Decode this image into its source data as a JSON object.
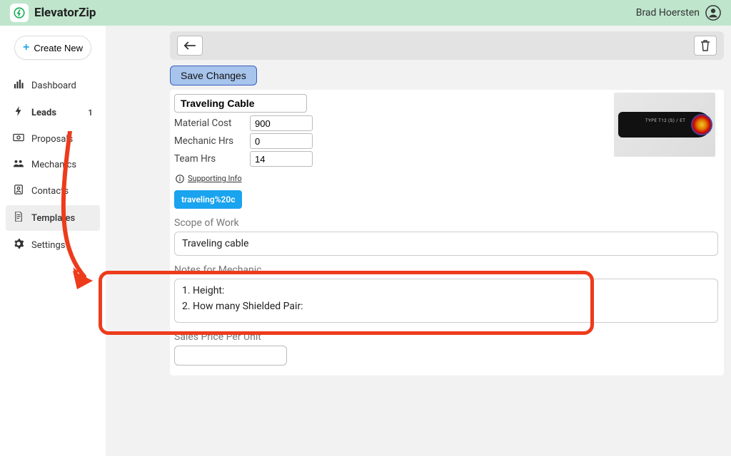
{
  "app_name": "ElevatorZip",
  "user_name": "Brad Hoersten",
  "sidebar": {
    "create_label": "Create New",
    "items": [
      {
        "label": "Dashboard"
      },
      {
        "label": "Leads",
        "badge": "1"
      },
      {
        "label": "Proposals"
      },
      {
        "label": "Mechanics"
      },
      {
        "label": "Contacts"
      },
      {
        "label": "Templates"
      },
      {
        "label": "Settings"
      }
    ]
  },
  "actions": {
    "save": "Save Changes"
  },
  "form": {
    "title": "Traveling Cable",
    "rows": {
      "material_cost": {
        "label": "Material Cost",
        "value": "900"
      },
      "mechanic_hrs": {
        "label": "Mechanic Hrs",
        "value": "0"
      },
      "team_hrs": {
        "label": "Team Hrs",
        "value": "14"
      }
    },
    "supporting_info": "Supporting Info",
    "chip": "traveling%20c",
    "scope": {
      "label": "Scope of Work",
      "value": "Traveling cable"
    },
    "notes": {
      "label": "Notes for Mechanic",
      "lines": [
        "1. Height:",
        "2. How many Shielded Pair:"
      ]
    },
    "sales": {
      "label": "Sales Price Per Unit",
      "value": ""
    }
  }
}
